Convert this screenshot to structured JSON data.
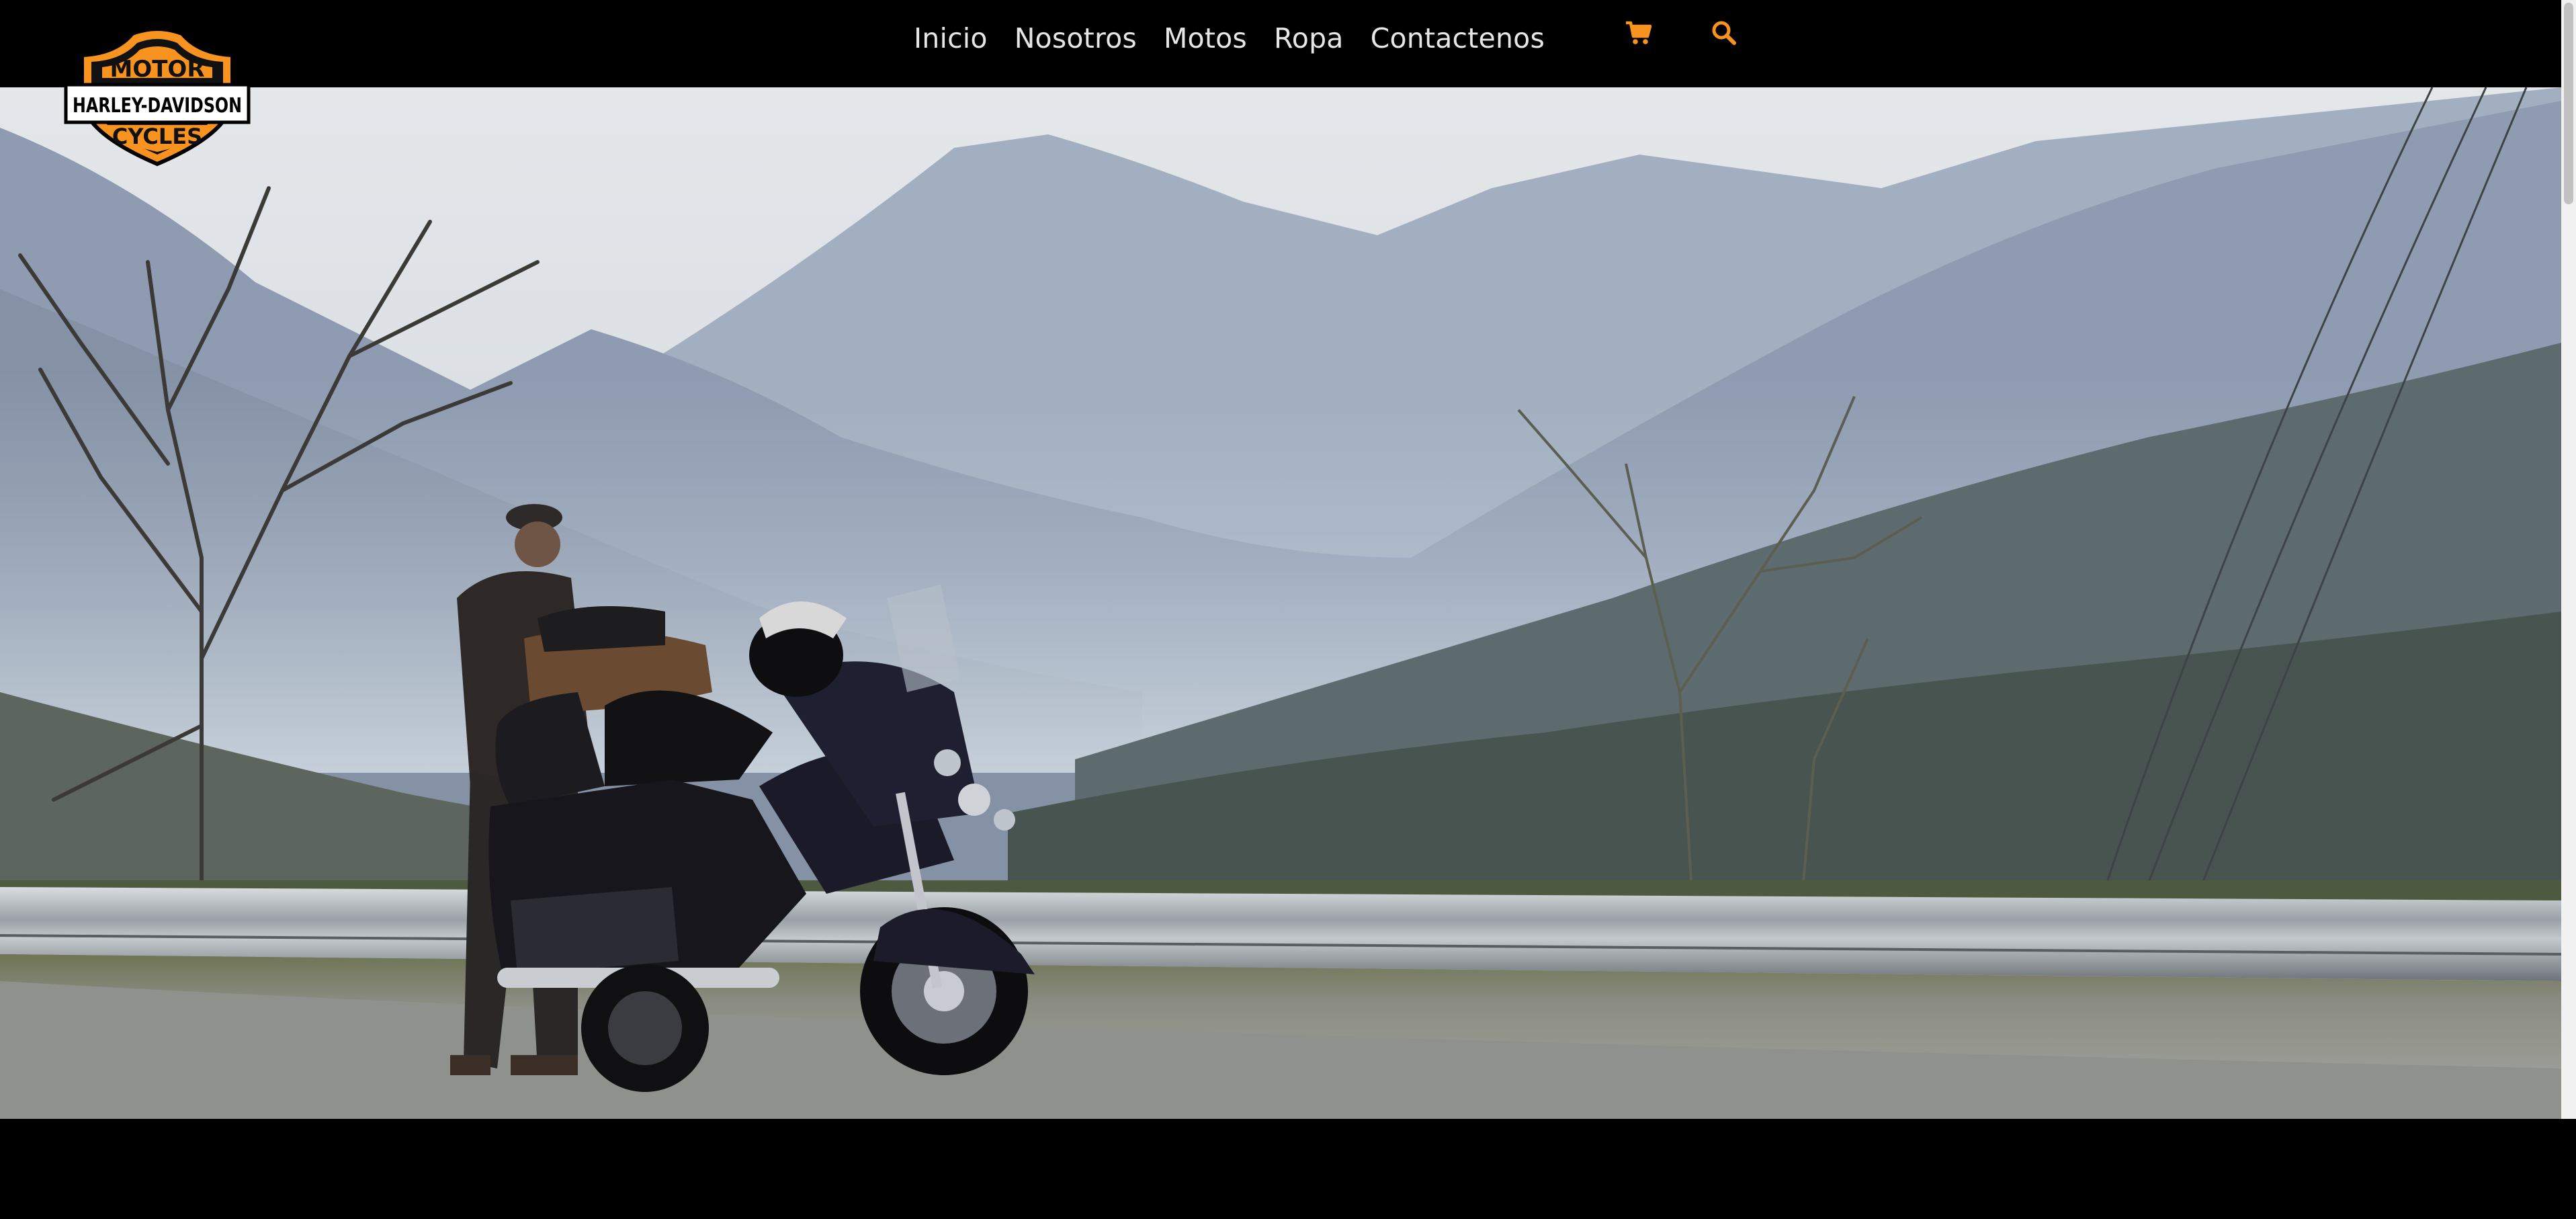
{
  "brand": {
    "logo_top_text": "MOTOR",
    "logo_middle_text": "HARLEY-DAVIDSON",
    "logo_bottom_text": "CYCLES",
    "logo_icon": "harley-davidson-bar-and-shield-logo",
    "logo_color": "#f7931e"
  },
  "nav": {
    "items": [
      {
        "label": "Inicio"
      },
      {
        "label": "Nosotros"
      },
      {
        "label": "Motos"
      },
      {
        "label": "Ropa"
      },
      {
        "label": "Contactenos"
      }
    ],
    "cart_icon": "shopping-cart-icon",
    "search_icon": "search-icon",
    "icon_color": "#f7931e",
    "link_color": "#e6e6e6",
    "background": "#000000"
  },
  "hero": {
    "image_icon": "hero-photo-rider-with-motorcycle-mountain-road"
  }
}
